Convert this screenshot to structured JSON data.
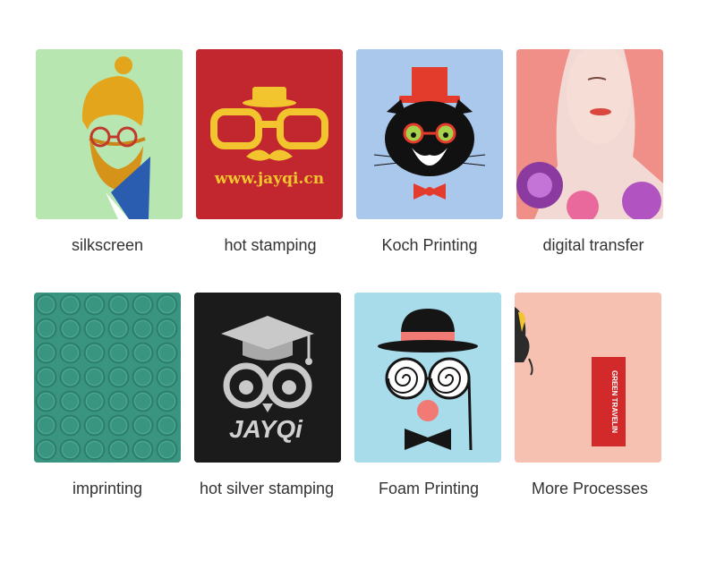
{
  "items": [
    {
      "label": "silkscreen",
      "background": "#b8e6b0"
    },
    {
      "label": "hot stamping",
      "background": "#c2262e",
      "imprint_text": "www.jayqi.cn"
    },
    {
      "label": "Koch Printing",
      "background": "#a9c8ec"
    },
    {
      "label": "digital transfer",
      "background": "#f3d9d4"
    },
    {
      "label": "imprinting",
      "background": "#3a9580"
    },
    {
      "label": "hot silver stamping",
      "background": "#1b1b1b",
      "imprint_text": "JAYQi"
    },
    {
      "label": "Foam Printing",
      "background": "#a8dcea"
    },
    {
      "label": "More Processes",
      "background": "#f7c1b2",
      "tag_text": "GREEN TRAVELIN"
    }
  ]
}
